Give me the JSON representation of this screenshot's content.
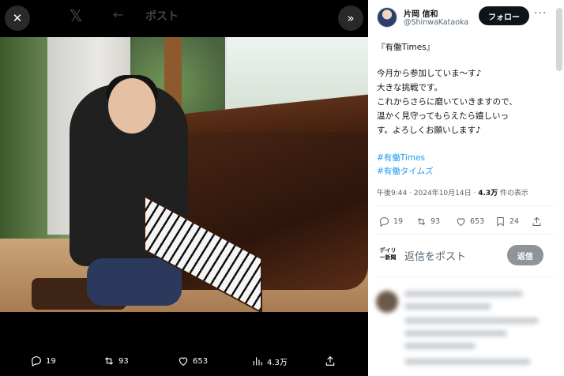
{
  "viewer": {
    "close_icon": "close-icon",
    "next_icon": "chevrons-right-icon",
    "ghost_title": "ポスト",
    "stats": {
      "replies": "19",
      "reposts": "93",
      "likes": "653",
      "views": "4.3万"
    }
  },
  "author": {
    "display_name": "片岡 信和",
    "handle": "@ShinwaKataoka",
    "follow_label": "フォロー"
  },
  "tweet": {
    "lines": [
      "『有働Times』",
      "今月から参加していま～す♪",
      "大きな挑戦です。",
      "これからさらに磨いていきますので、",
      "温かく見守ってもらえたら嬉しいっ",
      "す。よろしくお願いします♪"
    ],
    "hashtags": [
      "#有働Times",
      "#有働タイムズ"
    ],
    "time": "午後9:44 · 2024年10月14日 · ",
    "views_count": "4.3万",
    "views_suffix": " 件の表示"
  },
  "actions": {
    "replies": "19",
    "reposts": "93",
    "likes": "653",
    "bookmarks": "24"
  },
  "reply": {
    "avatar_text": "デイリー新聞",
    "placeholder": "返信をポスト",
    "button_label": "返信"
  }
}
